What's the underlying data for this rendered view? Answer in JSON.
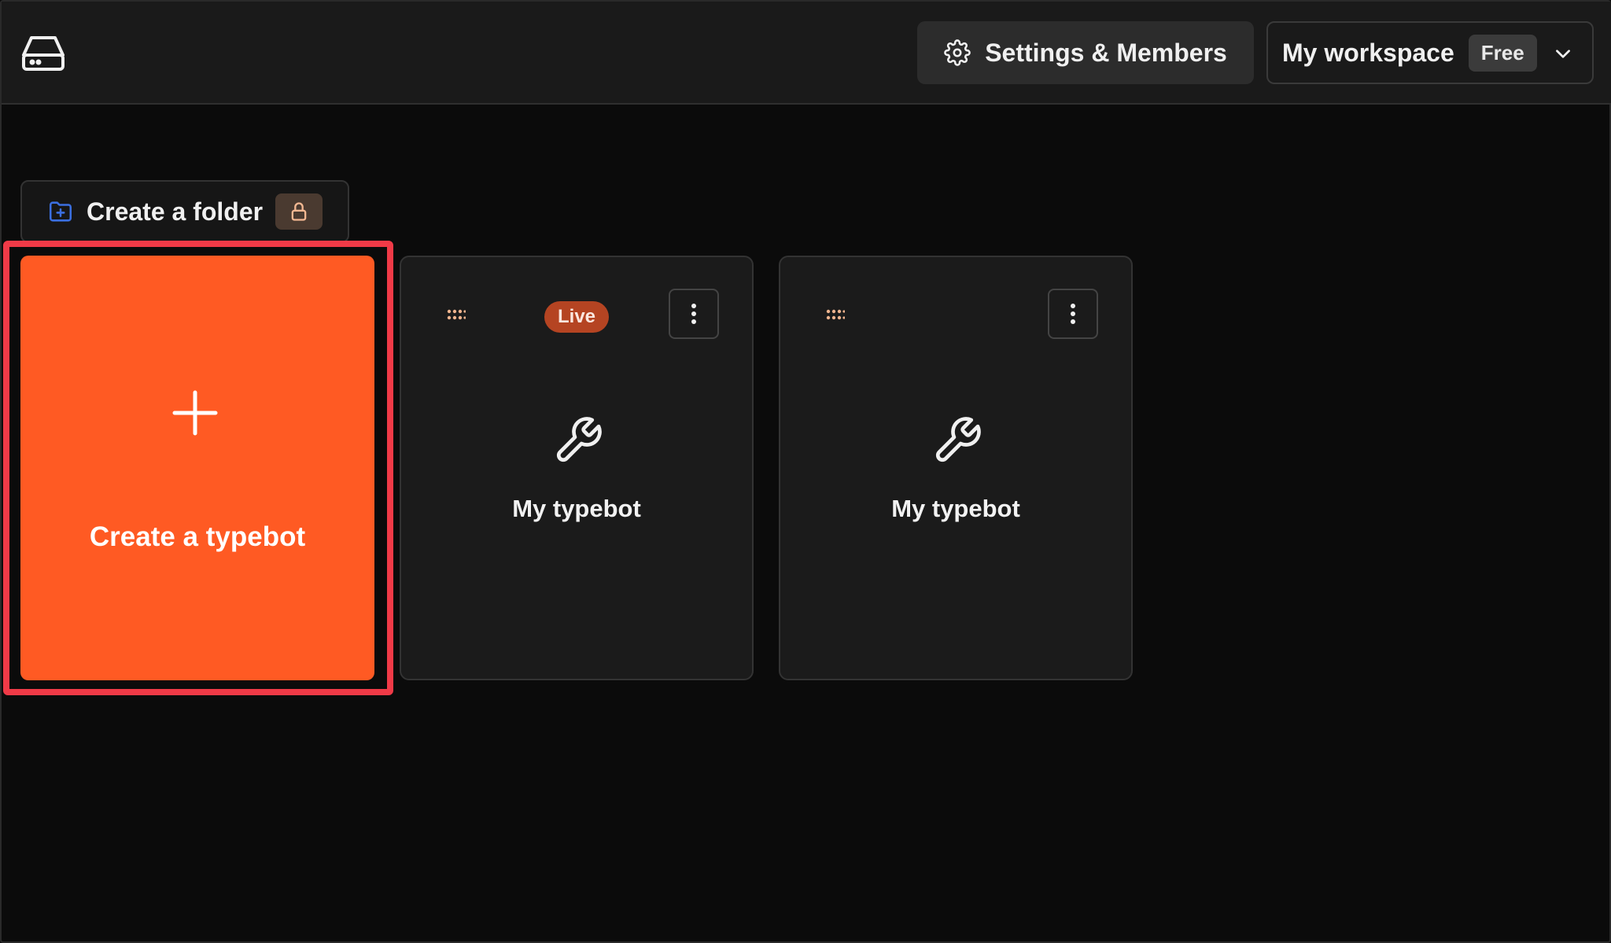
{
  "header": {
    "logo_icon": "hard-drive-icon",
    "settings_label": "Settings & Members",
    "settings_icon": "gear-icon",
    "workspace_name": "My workspace",
    "workspace_plan": "Free",
    "workspace_dropdown_icon": "chevron-down-icon"
  },
  "toolbar": {
    "create_folder_label": "Create a folder",
    "create_folder_icon": "folder-plus-icon",
    "lock_icon": "lock-icon"
  },
  "create_card": {
    "label": "Create a typebot",
    "icon": "plus-icon"
  },
  "typebots": [
    {
      "name": "My typebot",
      "status": "Live",
      "icon": "wrench-icon"
    },
    {
      "name": "My typebot",
      "status": "",
      "icon": "wrench-icon"
    }
  ],
  "colors": {
    "accent_orange": "#ff5a23",
    "highlight_red": "#f03a47",
    "live_badge": "#b54422",
    "folder_icon_blue": "#3b6fe0"
  }
}
